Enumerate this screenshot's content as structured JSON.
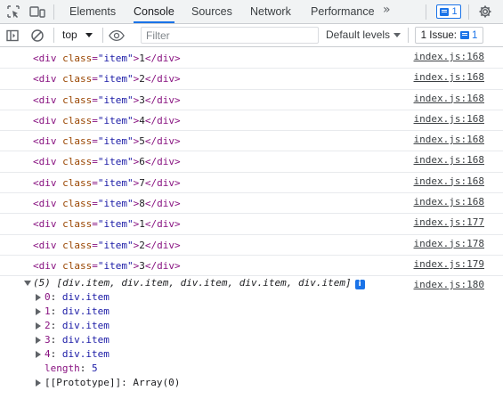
{
  "tabbar": {
    "tabs": [
      {
        "label": "Elements"
      },
      {
        "label": "Console"
      },
      {
        "label": "Sources"
      },
      {
        "label": "Network"
      },
      {
        "label": "Performance"
      }
    ],
    "more": "»",
    "messages_count": "1"
  },
  "toolbar": {
    "context": "top",
    "filter_placeholder": "Filter",
    "levels": "Default levels",
    "issues_label": "1 Issue:",
    "issues_count": "1"
  },
  "console": {
    "messages": [
      {
        "tag_open": "<div ",
        "attr": "class",
        "eq": "=",
        "value": "\"item\"",
        "close": ">",
        "text": "1",
        "tag_close": "</div>",
        "source": "index.js:168"
      },
      {
        "tag_open": "<div ",
        "attr": "class",
        "eq": "=",
        "value": "\"item\"",
        "close": ">",
        "text": "2",
        "tag_close": "</div>",
        "source": "index.js:168"
      },
      {
        "tag_open": "<div ",
        "attr": "class",
        "eq": "=",
        "value": "\"item\"",
        "close": ">",
        "text": "3",
        "tag_close": "</div>",
        "source": "index.js:168"
      },
      {
        "tag_open": "<div ",
        "attr": "class",
        "eq": "=",
        "value": "\"item\"",
        "close": ">",
        "text": "4",
        "tag_close": "</div>",
        "source": "index.js:168"
      },
      {
        "tag_open": "<div ",
        "attr": "class",
        "eq": "=",
        "value": "\"item\"",
        "close": ">",
        "text": "5",
        "tag_close": "</div>",
        "source": "index.js:168"
      },
      {
        "tag_open": "<div ",
        "attr": "class",
        "eq": "=",
        "value": "\"item\"",
        "close": ">",
        "text": "6",
        "tag_close": "</div>",
        "source": "index.js:168"
      },
      {
        "tag_open": "<div ",
        "attr": "class",
        "eq": "=",
        "value": "\"item\"",
        "close": ">",
        "text": "7",
        "tag_close": "</div>",
        "source": "index.js:168"
      },
      {
        "tag_open": "<div ",
        "attr": "class",
        "eq": "=",
        "value": "\"item\"",
        "close": ">",
        "text": "8",
        "tag_close": "</div>",
        "source": "index.js:168"
      },
      {
        "tag_open": "<div ",
        "attr": "class",
        "eq": "=",
        "value": "\"item\"",
        "close": ">",
        "text": "1",
        "tag_close": "</div>",
        "source": "index.js:177"
      },
      {
        "tag_open": "<div ",
        "attr": "class",
        "eq": "=",
        "value": "\"item\"",
        "close": ">",
        "text": "2",
        "tag_close": "</div>",
        "source": "index.js:178"
      },
      {
        "tag_open": "<div ",
        "attr": "class",
        "eq": "=",
        "value": "\"item\"",
        "close": ">",
        "text": "3",
        "tag_close": "</div>",
        "source": "index.js:179"
      }
    ],
    "array_group": {
      "summary": "(5) [div.item, div.item, div.item, div.item, div.item]",
      "info": "i",
      "source": "index.js:180",
      "entries": [
        {
          "key": "0",
          "value": "div.item"
        },
        {
          "key": "1",
          "value": "div.item"
        },
        {
          "key": "2",
          "value": "div.item"
        },
        {
          "key": "3",
          "value": "div.item"
        },
        {
          "key": "4",
          "value": "div.item"
        }
      ],
      "length_key": "length",
      "length_value": "5",
      "prototype": "[[Prototype]]: Array(0)"
    }
  },
  "colors": {
    "accent": "#1a73e8",
    "tag": "#881280",
    "attr_name": "#994500",
    "attr_value": "#1a1aa6"
  }
}
